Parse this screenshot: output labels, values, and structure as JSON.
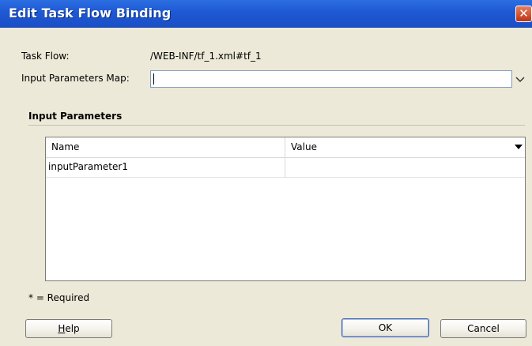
{
  "window": {
    "title": "Edit Task Flow Binding",
    "close_glyph": "✕"
  },
  "fields": {
    "task_flow_label": "Task Flow:",
    "task_flow_value": "/WEB-INF/tf_1.xml#tf_1",
    "input_map_label": "Input Parameters Map:",
    "input_map_value": ""
  },
  "section": {
    "title": "Input Parameters"
  },
  "table": {
    "columns": [
      "Name",
      "Value"
    ],
    "rows": [
      {
        "name": "inputParameter1",
        "value": ""
      }
    ]
  },
  "footer": {
    "required_note": "* = Required"
  },
  "buttons": {
    "help_first": "H",
    "help_rest": "elp",
    "ok": "OK",
    "cancel": "Cancel"
  },
  "colors": {
    "titlebar": "#1f58d3",
    "dialog_bg": "#ece9d8",
    "close": "#d4502e"
  }
}
